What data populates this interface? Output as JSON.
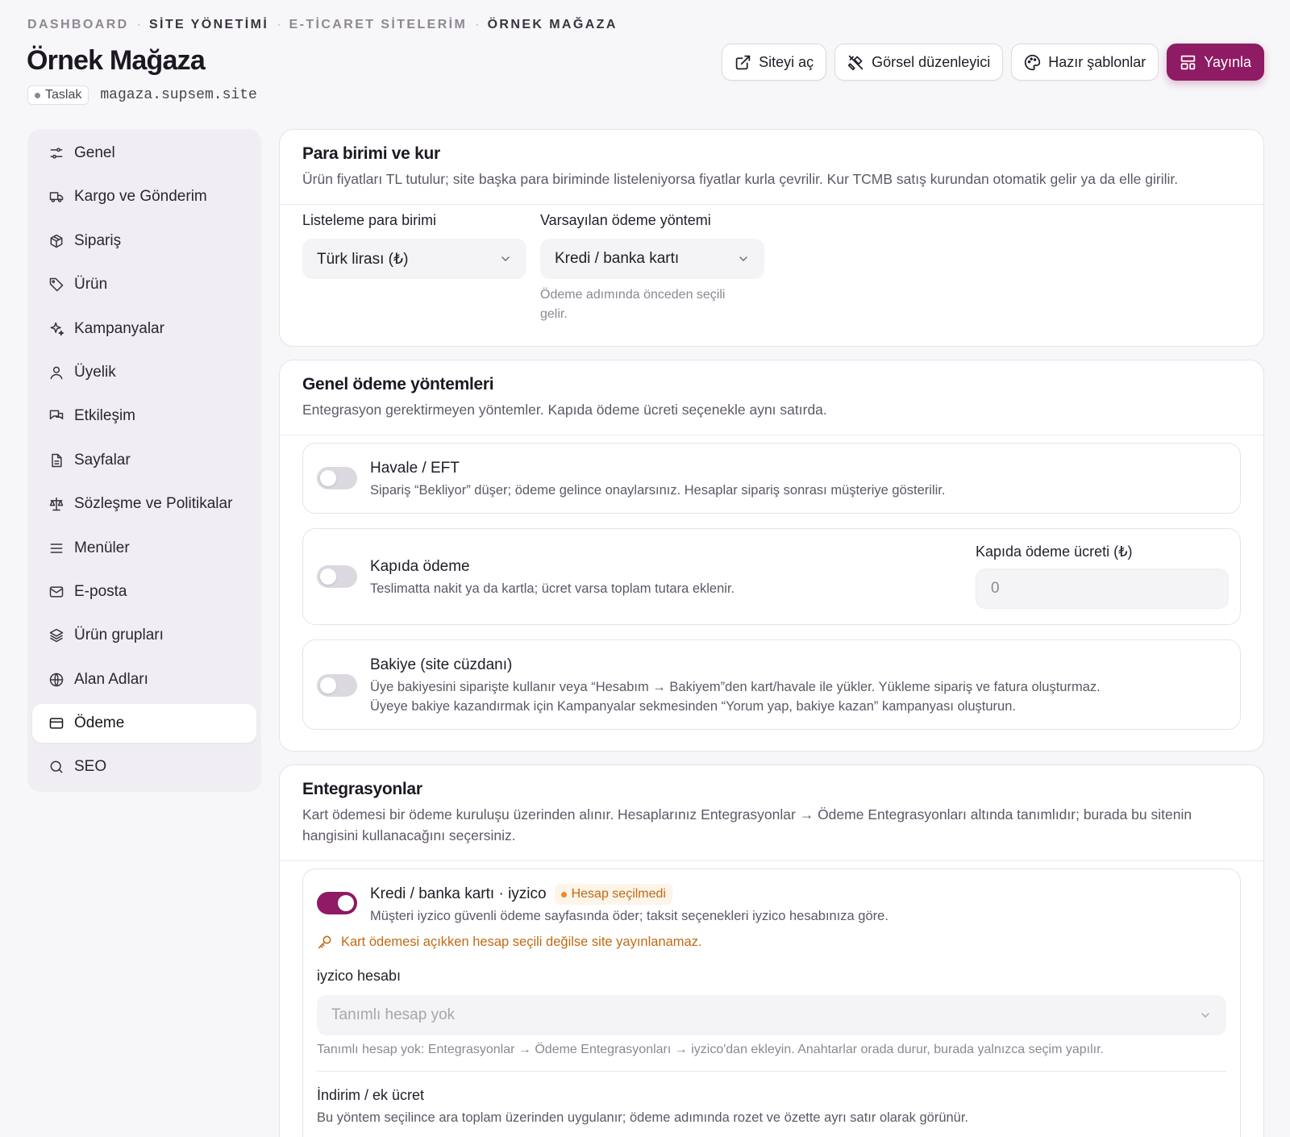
{
  "breadcrumb": [
    "DASHBOARD",
    "SİTE YÖNETİMİ",
    "E-TİCARET SİTELERİM",
    "ÖRNEK MAĞAZA"
  ],
  "page": {
    "title": "Örnek Mağaza",
    "status": "Taslak",
    "domain": "magaza.supsem.site"
  },
  "actions": {
    "open_site": "Siteyi aç",
    "visual_editor": "Görsel düzenleyici",
    "templates": "Hazır şablonlar",
    "publish": "Yayınla"
  },
  "sidebar": {
    "items": [
      {
        "label": "Genel",
        "icon": "sliders-icon"
      },
      {
        "label": "Kargo ve Gönderim",
        "icon": "truck-icon"
      },
      {
        "label": "Sipariş",
        "icon": "package-icon"
      },
      {
        "label": "Ürün",
        "icon": "tag-icon"
      },
      {
        "label": "Kampanyalar",
        "icon": "sparkles-icon"
      },
      {
        "label": "Üyelik",
        "icon": "user-icon"
      },
      {
        "label": "Etkileşim",
        "icon": "messages-icon"
      },
      {
        "label": "Sayfalar",
        "icon": "file-icon"
      },
      {
        "label": "Sözleşme ve Politikalar",
        "icon": "scale-icon"
      },
      {
        "label": "Menüler",
        "icon": "menu-icon"
      },
      {
        "label": "E-posta",
        "icon": "mail-icon"
      },
      {
        "label": "Ürün grupları",
        "icon": "layers-icon"
      },
      {
        "label": "Alan Adları",
        "icon": "globe-icon"
      },
      {
        "label": "Ödeme",
        "icon": "credit-card-icon",
        "active": true
      },
      {
        "label": "SEO",
        "icon": "search-icon"
      }
    ]
  },
  "currency": {
    "title": "Para birimi ve kur",
    "desc": "Ürün fiyatları TL tutulur; site başka para biriminde listeleniyorsa fiyatlar kurla çevrilir. Kur TCMB satış kurundan otomatik gelir ya da elle girilir.",
    "list_label": "Listeleme para birimi",
    "list_value": "Türk lirası (₺)",
    "method_label": "Varsayılan ödeme yöntemi",
    "method_value": "Kredi / banka kartı",
    "method_hint": "Ödeme adımında önceden seçili gelir."
  },
  "general": {
    "title": "Genel ödeme yöntemleri",
    "desc": "Entegrasyon gerektirmeyen yöntemler. Kapıda ödeme ücreti seçenekle aynı satırda.",
    "havale_title": "Havale / EFT",
    "havale_desc": "Sipariş “Bekliyor” düşer; ödeme gelince onaylarsınız. Hesaplar sipariş sonrası müşteriye gösterilir.",
    "havale_on": false,
    "kapida_title": "Kapıda ödeme",
    "kapida_desc": "Teslimatta nakit ya da kartla; ücret varsa toplam tutara eklenir.",
    "kapida_on": false,
    "kapida_fee_label": "Kapıda ödeme ücreti (₺)",
    "kapida_fee_placeholder": "0",
    "bakiye_title": "Bakiye (site cüzdanı)",
    "bakiye_desc1": "Üye bakiyesini siparişte kullanır veya “Hesabım → Bakiyem”den kart/havale ile yükler. Yükleme sipariş ve fatura oluşturmaz.",
    "bakiye_desc2": "Üyeye bakiye kazandırmak için Kampanyalar sekmesinden “Yorum yap, bakiye kazan” kampanyası oluşturun.",
    "bakiye_on": false
  },
  "integrations": {
    "title": "Entegrasyonlar",
    "desc1": "Kart ödemesi bir ödeme kuruluşu üzerinden alınır. Hesaplarınız Entegrasyonlar → Ödeme Entegrasyonları altında tanımlıdır; burada bu sitenin",
    "desc2": "hangisini kullanacağını seçersiniz.",
    "card_title": "Kredi / banka kartı · iyzico",
    "card_badge": "Hesap seçilmedi",
    "card_desc": "Müşteri iyzico güvenli ödeme sayfasında öder; taksit seçenekleri iyzico hesabınıza göre.",
    "card_on": true,
    "warning": "Kart ödemesi açıkken hesap seçili değilse site yayınlanamaz.",
    "account_label": "iyzico hesabı",
    "account_placeholder": "Tanımlı hesap yok",
    "account_hint": "Tanımlı hesap yok: Entegrasyonlar → Ödeme Entegrasyonları → iyzico'dan ekleyin. Anahtarlar orada durur, burada yalnızca seçim yapılır.",
    "discount_label": "İndirim / ek ücret",
    "discount_desc": "Bu yöntem seçilince ara toplam üzerinden uygulanır; ödeme adımında rozet ve özette ayrı satır olarak görünür."
  },
  "colors": {
    "accent": "#8e1b63",
    "warning": "#c06a12"
  }
}
